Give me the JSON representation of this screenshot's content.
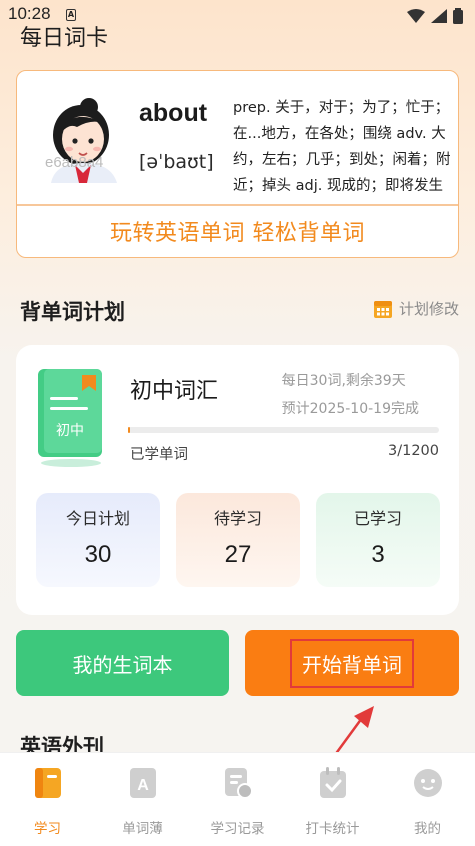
{
  "status_bar": {
    "time": "10:28",
    "notification_icon": "A"
  },
  "page": {
    "title": "每日词卡"
  },
  "word_card": {
    "watermark": "e6ab8a4",
    "word": "about",
    "phonetic": "[əˈbaʊt]",
    "definition": "prep. 关于，对于；为了；忙于；在...地方，在各处；围绕 adv. 大约，左右；几乎；到处；闲着；附近；掉头 adj. 现成的；即将发生的",
    "slogan": "玩转英语单词 轻松背单词"
  },
  "plan_section": {
    "title": "背单词计划",
    "edit_label": "计划修改",
    "book_cover_label": "初中",
    "book_name": "初中词汇",
    "daily_info": "每日30词,剩余39天",
    "estimate_info": "预计2025-10-19完成",
    "learned_label": "已学单词",
    "learned_count": "3/1200",
    "progress_fraction": 0.0025,
    "stats": {
      "today": {
        "label": "今日计划",
        "value": "30"
      },
      "pending": {
        "label": "待学习",
        "value": "27"
      },
      "done": {
        "label": "已学习",
        "value": "3"
      }
    }
  },
  "actions": {
    "vocab_book": "我的生词本",
    "start": "开始背单词"
  },
  "magazine": {
    "title": "英语外刊"
  },
  "tabs": [
    {
      "label": "学习",
      "icon": "book-icon",
      "active": true
    },
    {
      "label": "单词薄",
      "icon": "letter-a-icon",
      "active": false
    },
    {
      "label": "学习记录",
      "icon": "record-icon",
      "active": false
    },
    {
      "label": "打卡统计",
      "icon": "calendar-check-icon",
      "active": false
    },
    {
      "label": "我的",
      "icon": "profile-icon",
      "active": false
    }
  ],
  "colors": {
    "accent": "#f28a1e",
    "green": "#3dc87c",
    "orange_button": "#fa7d12",
    "highlight_box": "#e23a3a"
  }
}
